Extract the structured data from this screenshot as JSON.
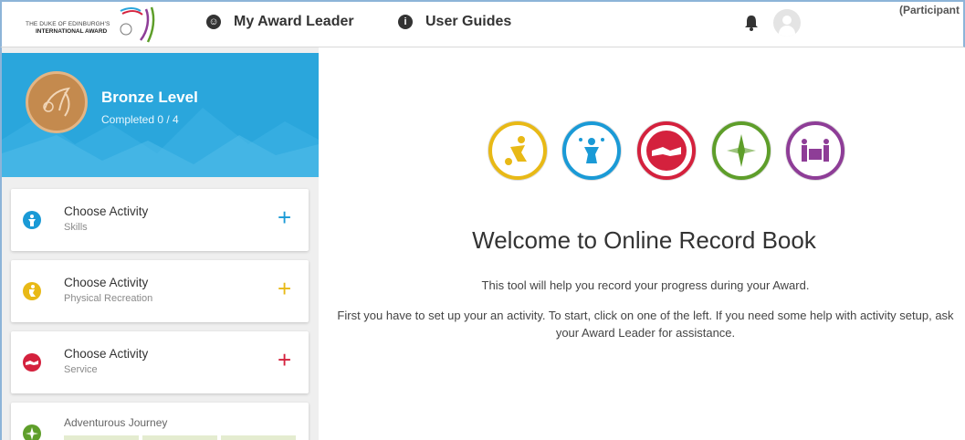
{
  "header": {
    "logo_line1": "THE DUKE OF EDINBURGH'S",
    "logo_line2": "INTERNATIONAL AWARD",
    "nav": [
      {
        "label": "My Award Leader",
        "icon": "face-icon"
      },
      {
        "label": "User Guides",
        "icon": "info-icon"
      }
    ],
    "role": "(Participant"
  },
  "level": {
    "title": "Bronze Level",
    "progress": "Completed 0 / 4"
  },
  "activities": [
    {
      "title": "Choose Activity",
      "subtitle": "Skills",
      "color": "#1a9ad6",
      "icon": "skills-icon"
    },
    {
      "title": "Choose Activity",
      "subtitle": "Physical Recreation",
      "color": "#e8b916",
      "icon": "physical-recreation-icon"
    },
    {
      "title": "Choose Activity",
      "subtitle": "Service",
      "color": "#d4213d",
      "icon": "service-icon"
    }
  ],
  "journey": {
    "title": "Adventurous Journey",
    "color": "#5e9e2a",
    "icon": "compass-icon"
  },
  "welcome": {
    "title": "Welcome to Online Record Book",
    "line1": "This tool will help you record your progress during your Award.",
    "line2": "First you have to set up your an activity. To start, click on one of the left. If you need some help with activity setup, ask your Award Leader for assistance."
  },
  "colors": {
    "accent": "#2aa6dc",
    "physical": "#e8b916",
    "skills": "#1a9ad6",
    "service": "#d4213d",
    "journey": "#5e9e2a",
    "residential": "#8e3d97"
  }
}
